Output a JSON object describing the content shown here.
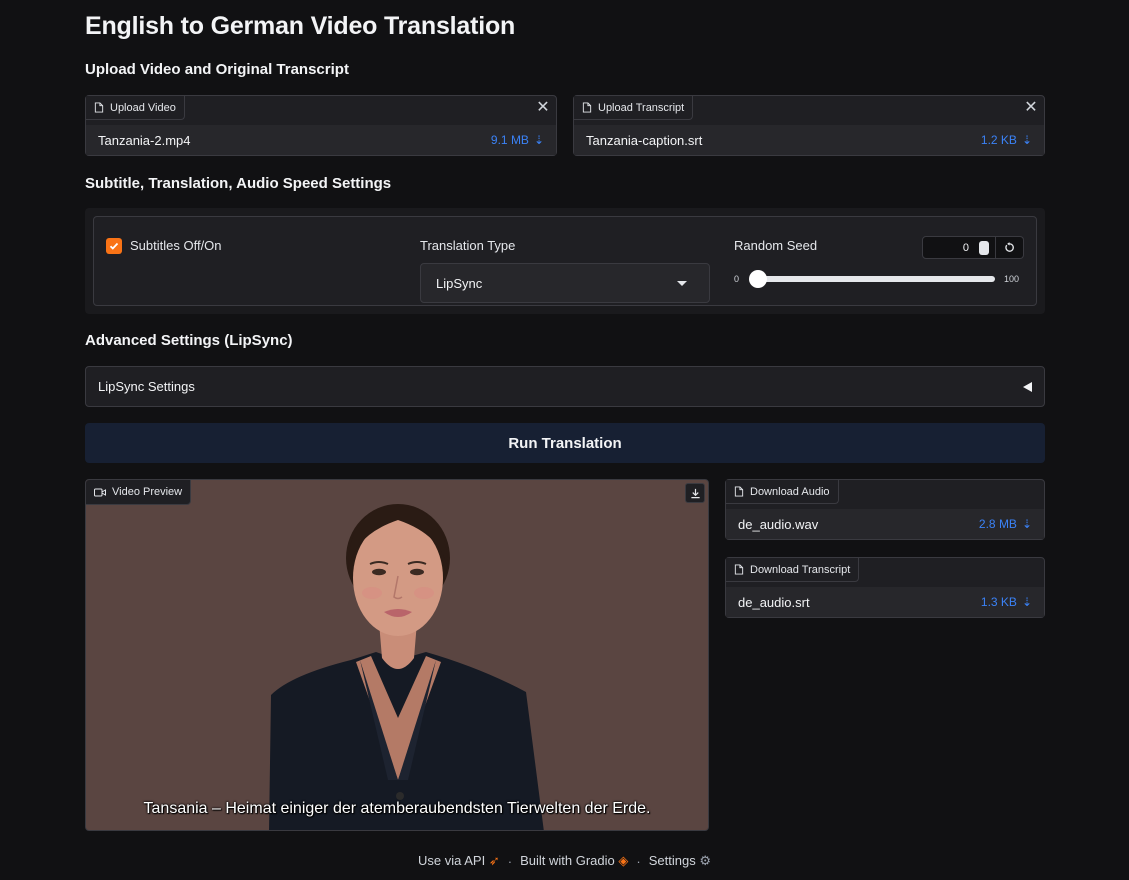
{
  "page": {
    "title": "English to German Video Translation"
  },
  "upload_section": {
    "heading": "Upload Video and Original Transcript",
    "video": {
      "tag": "Upload Video",
      "filename": "Tanzania-2.mp4",
      "size": "9.1 MB"
    },
    "transcript": {
      "tag": "Upload Transcript",
      "filename": "Tanzania-caption.srt",
      "size": "1.2 KB"
    }
  },
  "settings_section": {
    "heading": "Subtitle, Translation, Audio Speed Settings",
    "subtitles": {
      "label": "Subtitles Off/On",
      "checked": true
    },
    "translation_type": {
      "label": "Translation Type",
      "value": "LipSync"
    },
    "random_seed": {
      "label": "Random Seed",
      "value": "0",
      "min": "0",
      "max": "100",
      "level": 0
    }
  },
  "advanced_section": {
    "heading": "Advanced Settings (LipSync)",
    "accordion_label": "LipSync Settings"
  },
  "run_button": {
    "label": "Run Translation"
  },
  "video_preview": {
    "tag": "Video Preview",
    "subtitle": "Tansania – Heimat einiger der atemberaubendsten Tierwelten der Erde."
  },
  "downloads": {
    "audio": {
      "tag": "Download Audio",
      "filename": "de_audio.wav",
      "size": "2.8 MB"
    },
    "transcript": {
      "tag": "Download Transcript",
      "filename": "de_audio.srt",
      "size": "1.3 KB"
    }
  },
  "footer": {
    "api": "Use via API",
    "built": "Built with Gradio",
    "settings": "Settings"
  },
  "colors": {
    "accent": "#f97316",
    "link": "#3b82f6",
    "background": "#111113",
    "run_button": "#172033"
  }
}
